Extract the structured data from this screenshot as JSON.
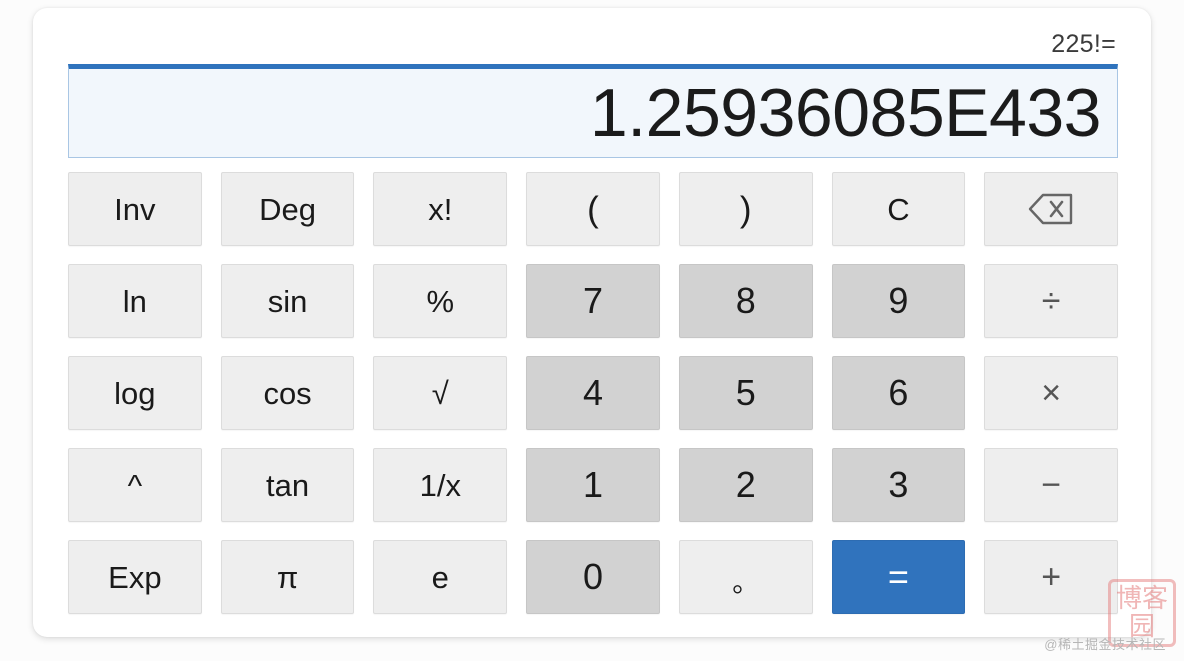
{
  "display": {
    "expression": "225!=",
    "value": "1.25936085E433"
  },
  "colors": {
    "accent_blue": "#3073bd",
    "display_border_blue": "#2f73bd",
    "display_background": "#f2f7fc",
    "function_key": "#eeeeee",
    "number_key": "#d2d2d2",
    "operator_text": "#555555"
  },
  "keypad": {
    "rows": [
      [
        {
          "label": "Inv",
          "name": "key-inv",
          "kind": "func"
        },
        {
          "label": "Deg",
          "name": "key-deg",
          "kind": "func"
        },
        {
          "label": "x!",
          "name": "key-factorial",
          "kind": "func"
        },
        {
          "label": "(",
          "name": "key-open-paren",
          "kind": "paren"
        },
        {
          "label": ")",
          "name": "key-close-paren",
          "kind": "paren"
        },
        {
          "label": "C",
          "name": "key-clear",
          "kind": "func"
        },
        {
          "label": "",
          "name": "key-backspace",
          "kind": "backspace"
        }
      ],
      [
        {
          "label": "ln",
          "name": "key-ln",
          "kind": "func"
        },
        {
          "label": "sin",
          "name": "key-sin",
          "kind": "func"
        },
        {
          "label": "%",
          "name": "key-percent",
          "kind": "func"
        },
        {
          "label": "7",
          "name": "key-7",
          "kind": "num"
        },
        {
          "label": "8",
          "name": "key-8",
          "kind": "num"
        },
        {
          "label": "9",
          "name": "key-9",
          "kind": "num"
        },
        {
          "label": "÷",
          "name": "key-divide",
          "kind": "op"
        }
      ],
      [
        {
          "label": "log",
          "name": "key-log",
          "kind": "func"
        },
        {
          "label": "cos",
          "name": "key-cos",
          "kind": "func"
        },
        {
          "label": "√",
          "name": "key-sqrt",
          "kind": "func"
        },
        {
          "label": "4",
          "name": "key-4",
          "kind": "num"
        },
        {
          "label": "5",
          "name": "key-5",
          "kind": "num"
        },
        {
          "label": "6",
          "name": "key-6",
          "kind": "num"
        },
        {
          "label": "×",
          "name": "key-multiply",
          "kind": "op"
        }
      ],
      [
        {
          "label": "^",
          "name": "key-power",
          "kind": "func"
        },
        {
          "label": "tan",
          "name": "key-tan",
          "kind": "func"
        },
        {
          "label": "1/x",
          "name": "key-reciprocal",
          "kind": "func"
        },
        {
          "label": "1",
          "name": "key-1",
          "kind": "num"
        },
        {
          "label": "2",
          "name": "key-2",
          "kind": "num"
        },
        {
          "label": "3",
          "name": "key-3",
          "kind": "num"
        },
        {
          "label": "−",
          "name": "key-minus",
          "kind": "op"
        }
      ],
      [
        {
          "label": "Exp",
          "name": "key-exp",
          "kind": "func"
        },
        {
          "label": "π",
          "name": "key-pi",
          "kind": "func"
        },
        {
          "label": "e",
          "name": "key-e",
          "kind": "func"
        },
        {
          "label": "0",
          "name": "key-0",
          "kind": "num"
        },
        {
          "label": "。",
          "name": "key-decimal",
          "kind": "dot"
        },
        {
          "label": "=",
          "name": "key-equals",
          "kind": "equals"
        },
        {
          "label": "+",
          "name": "key-plus",
          "kind": "op"
        }
      ]
    ]
  },
  "watermark": {
    "text": "@稀土掘金技术社区",
    "seal": "博客园"
  }
}
